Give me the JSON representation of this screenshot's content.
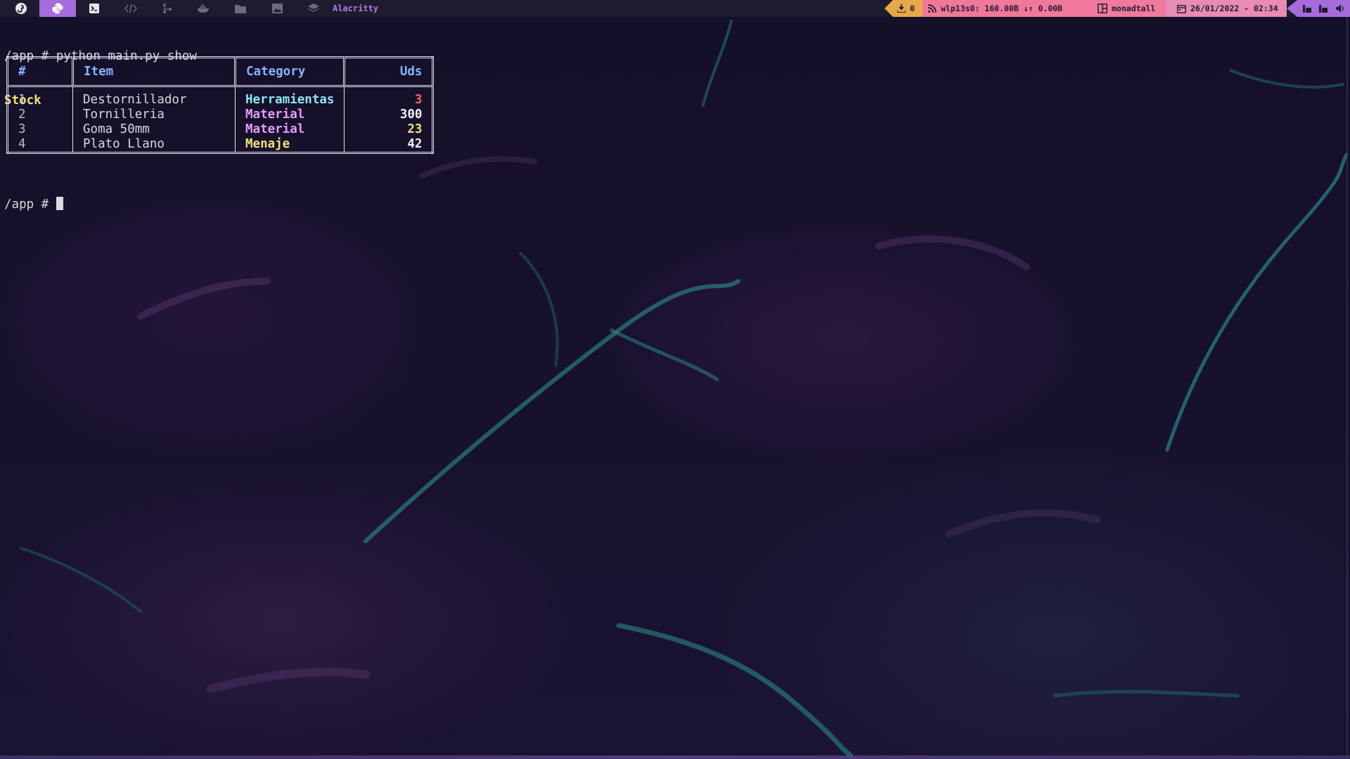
{
  "topbar": {
    "workspaces": [
      {
        "icon": "fedora-icon",
        "active": false
      },
      {
        "icon": "python-icon",
        "active": true
      },
      {
        "icon": "terminal-icon",
        "active": false
      },
      {
        "icon": "code-icon",
        "active": false
      },
      {
        "icon": "git-icon",
        "active": false
      },
      {
        "icon": "docker-icon",
        "active": false
      },
      {
        "icon": "folder-icon",
        "active": false
      },
      {
        "icon": "image-icon",
        "active": false
      },
      {
        "icon": "layers-icon",
        "active": false
      }
    ],
    "window_title": "Alacritty",
    "updates_count": "0",
    "network_label": "wlp13s0: 160.00B ↓↑  0.00B",
    "layout_name": "monadtall",
    "datetime": "26/01/2022 - 02:34",
    "colors": {
      "bar_bg": "#1d1b2e",
      "accent_purple": "#a66cdb",
      "updates_orange": "#e5a94a",
      "network_pink": "#f0789a",
      "clock_pink": "#e88bb5"
    }
  },
  "terminal": {
    "command_line": "/app # python main.py show",
    "table_title": "Stock",
    "prompt": "/app # ",
    "table": {
      "headers": [
        "#",
        "Item",
        "Category",
        "Uds"
      ],
      "rows": [
        {
          "num": "1",
          "item": "Destornillador",
          "category": "Herramientas",
          "uds": "3"
        },
        {
          "num": "2",
          "item": "Tornilleria",
          "category": "Material",
          "uds": "300"
        },
        {
          "num": "3",
          "item": "Goma 50mm",
          "category": "Material",
          "uds": "23"
        },
        {
          "num": "4",
          "item": "Plato Llano",
          "category": "Menaje",
          "uds": "42"
        }
      ]
    }
  }
}
